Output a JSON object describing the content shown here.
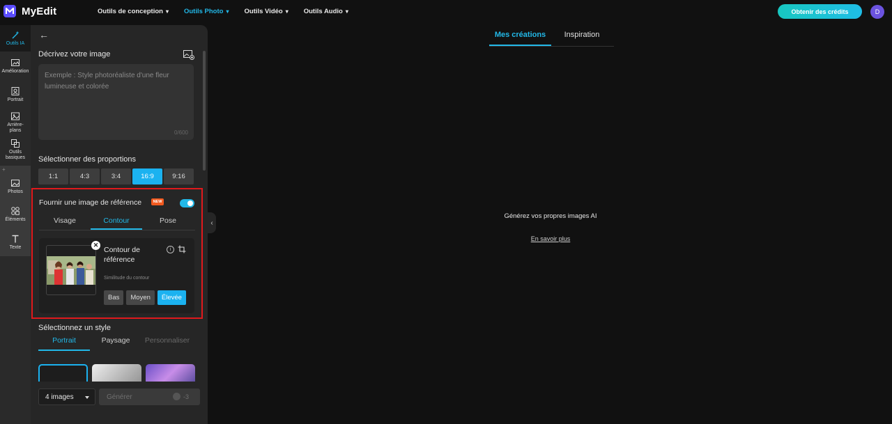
{
  "app": {
    "name": "MyEdit",
    "avatar_initial": "D",
    "credits_button": "Obtenir des crédits"
  },
  "nav": [
    {
      "label": "Outils de conception",
      "active": false
    },
    {
      "label": "Outils Photo",
      "active": true
    },
    {
      "label": "Outils Vidéo",
      "active": false
    },
    {
      "label": "Outils Audio",
      "active": false
    }
  ],
  "rail": [
    {
      "label": "Outils IA",
      "icon": "magic-wand-icon"
    },
    {
      "label": "Amélioration",
      "icon": "enhance-icon"
    },
    {
      "label": "Portrait",
      "icon": "portrait-icon"
    },
    {
      "label": "Arrière-plans",
      "icon": "background-icon"
    },
    {
      "label": "Outils basiques",
      "icon": "basic-tools-icon"
    },
    {
      "label": "Photos",
      "icon": "photo-icon"
    },
    {
      "label": "Éléments",
      "icon": "elements-icon"
    },
    {
      "label": "Texte",
      "icon": "text-icon"
    }
  ],
  "panel": {
    "describe_title": "Décrivez votre image",
    "prompt_placeholder": "Exemple : Style photoréaliste d'une fleur lumineuse et colorée",
    "prompt_counter": "0/600",
    "ratio_title": "Sélectionner des proportions",
    "ratios": [
      "1:1",
      "4:3",
      "3:4",
      "16:9",
      "9:16"
    ],
    "ratio_selected": "16:9",
    "reference": {
      "title": "Fournir une image de référence",
      "badge": "NEW",
      "enabled": true,
      "tabs": [
        "Visage",
        "Contour",
        "Pose"
      ],
      "active_tab": "Contour",
      "card_title": "Contour de référence",
      "similarity_label": "Similitude du contour",
      "levels": [
        "Bas",
        "Moyen",
        "Élevée"
      ],
      "level_selected": "Élevée"
    },
    "style_title": "Sélectionnez un style",
    "style_tabs": [
      "Portrait",
      "Paysage",
      "Personnaliser"
    ],
    "style_active_tab": "Portrait",
    "quantity": "4 images",
    "generate_label": "Générer",
    "generate_cost": "-3"
  },
  "main": {
    "tabs": [
      "Mes créations",
      "Inspiration"
    ],
    "active_tab": "Mes créations",
    "empty_title": "Générez vos propres images AI",
    "learn_more": "En savoir plus"
  },
  "colors": {
    "accent": "#22b8e8",
    "brand": "#5b4dff",
    "highlight_border": "#e0191c",
    "new_badge": "#f25a1f"
  }
}
